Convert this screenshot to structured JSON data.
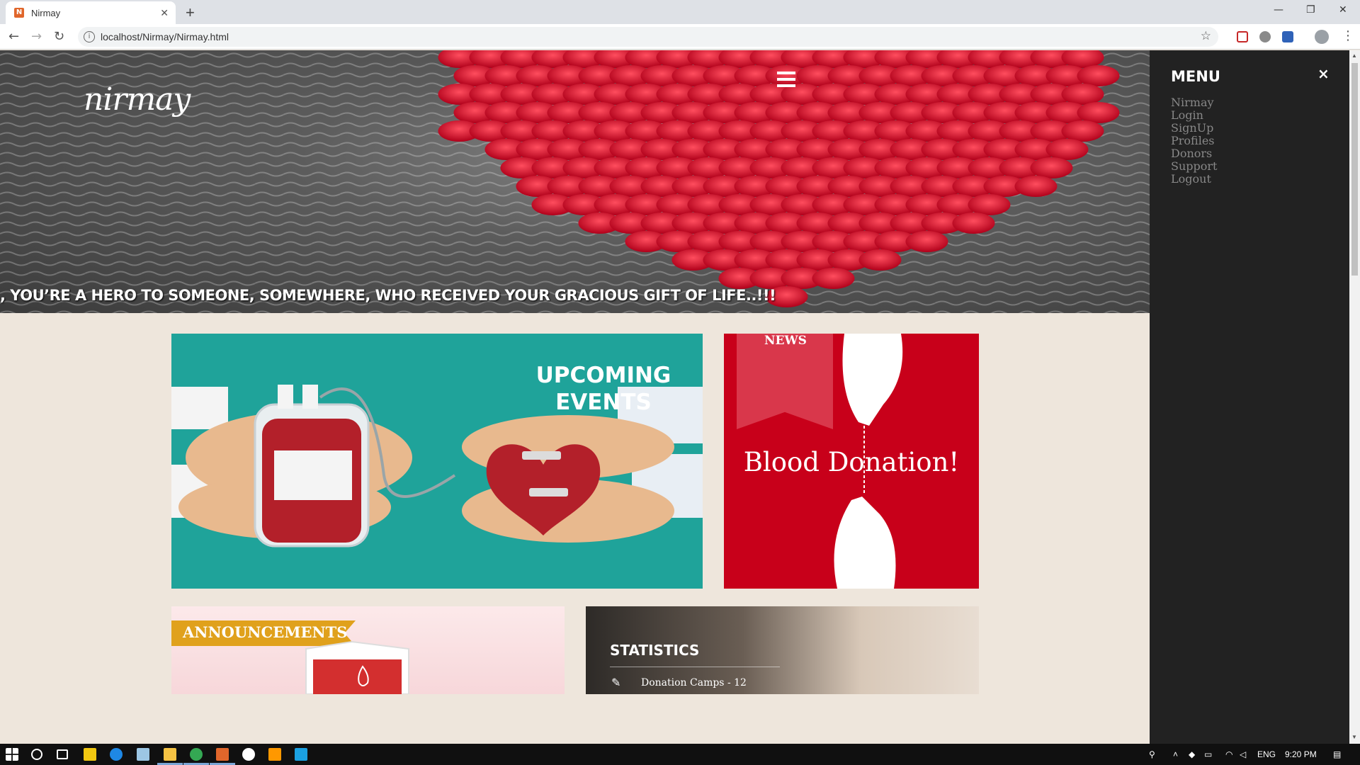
{
  "browser": {
    "tab_title": "Nirmay",
    "tab_favicon": "Nirmay-favicon",
    "new_tab": "+",
    "url": "localhost/Nirmay/Nirmay.html",
    "window_controls": [
      "minimize-icon",
      "restore-icon",
      "close-icon"
    ]
  },
  "hero": {
    "logo": "nirmay",
    "marquee": ", YOU’RE A HERO TO SOMEONE, SOMEWHERE, WHO RECEIVED YOUR GRACIOUS GIFT OF LIFE..!!!"
  },
  "sidebar": {
    "title": "MENU",
    "close": "×",
    "items": [
      {
        "label": "Nirmay"
      },
      {
        "label": "Login"
      },
      {
        "label": "SignUp"
      },
      {
        "label": "Profiles"
      },
      {
        "label": "Donors"
      },
      {
        "label": "Support"
      },
      {
        "label": "Logout"
      }
    ]
  },
  "cards": {
    "events": {
      "title_line1": "UPCOMING",
      "title_line2": "EVENTS"
    },
    "news": {
      "label": "NEWS",
      "text": "Blood Donation!"
    },
    "announcements": {
      "label": "ANNOUNCEMENTS"
    },
    "statistics": {
      "title": "STATISTICS",
      "item": "Donation Camps - 12"
    }
  },
  "taskbar": {
    "language": "ENG",
    "time": "9:20 PM"
  },
  "colors": {
    "events_bg": "#1fa39a",
    "news_bg": "#c8001a",
    "announce_tag": "#e0a11c",
    "sidebar_bg": "#222222",
    "page_bg": "#eee6dc"
  }
}
